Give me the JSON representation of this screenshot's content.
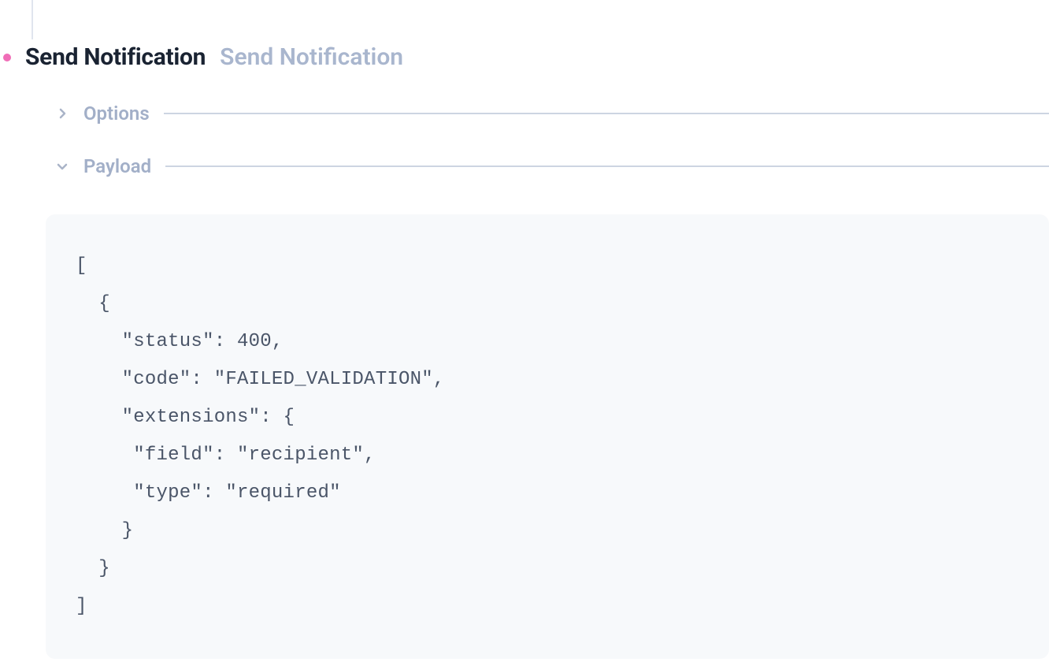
{
  "step": {
    "title": "Send Notification",
    "subtitle": "Send Notification"
  },
  "sections": {
    "options": {
      "label": "Options"
    },
    "payload": {
      "label": "Payload"
    }
  },
  "payload_code": "[\n  {\n    \"status\": 400,\n    \"code\": \"FAILED_VALIDATION\",\n    \"extensions\": {\n     \"field\": \"recipient\",\n     \"type\": \"required\"\n    }\n  }\n]"
}
